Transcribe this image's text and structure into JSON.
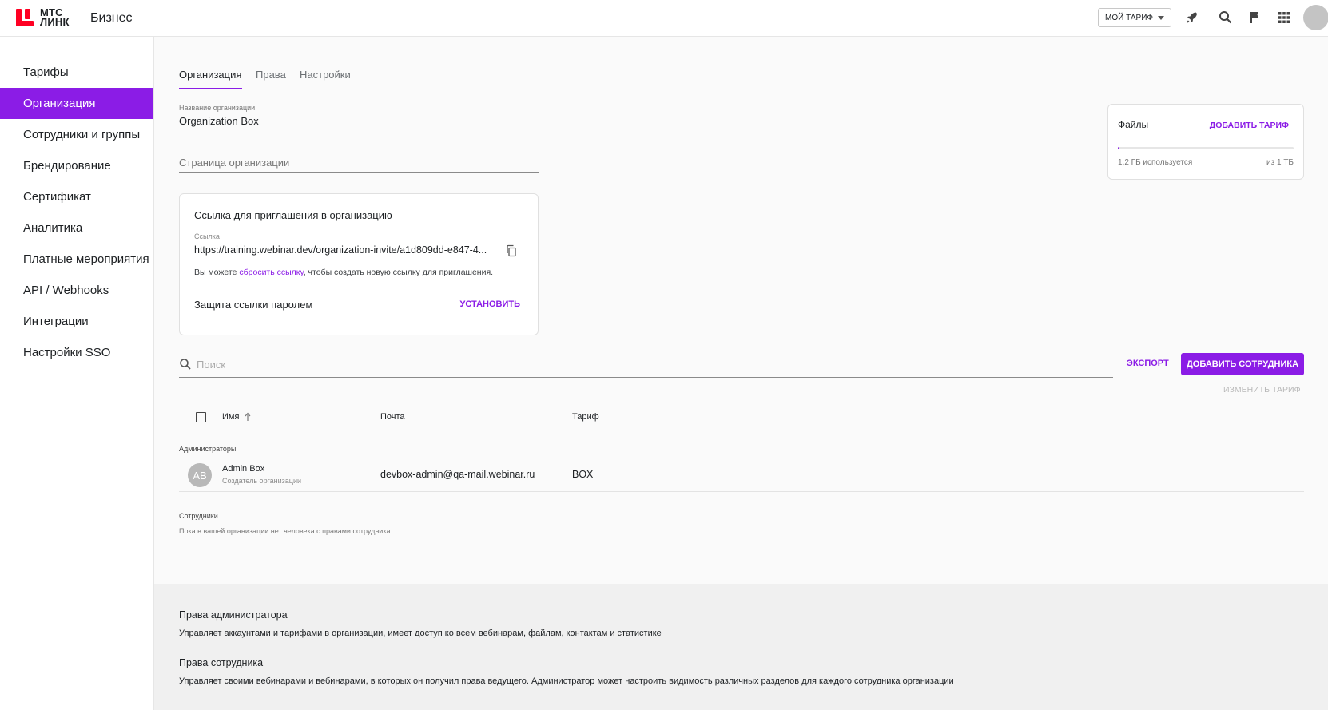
{
  "header": {
    "logo_line1": "МТС",
    "logo_line2": "ЛИНК",
    "product": "Бизнес",
    "tariff_button": "МОЙ ТАРИФ",
    "icons": [
      "rocket-icon",
      "search-icon",
      "flag-icon",
      "apps-grid-icon",
      "avatar"
    ]
  },
  "sidebar": {
    "items": [
      {
        "label": "Тарифы",
        "active": false
      },
      {
        "label": "Организация",
        "active": true
      },
      {
        "label": "Сотрудники и группы",
        "active": false
      },
      {
        "label": "Брендирование",
        "active": false
      },
      {
        "label": "Сертификат",
        "active": false
      },
      {
        "label": "Аналитика",
        "active": false
      },
      {
        "label": "Платные мероприятия",
        "active": false
      },
      {
        "label": "API / Webhooks",
        "active": false
      },
      {
        "label": "Интеграции",
        "active": false
      },
      {
        "label": "Настройки SSO",
        "active": false
      }
    ]
  },
  "tabs": [
    {
      "label": "Организация",
      "active": true
    },
    {
      "label": "Права",
      "active": false
    },
    {
      "label": "Настройки",
      "active": false
    }
  ],
  "org": {
    "name_label": "Название организации",
    "name_value": "Organization Box",
    "page_placeholder": "Страница организации"
  },
  "invite": {
    "title": "Ссылка для приглашения в организацию",
    "link_label": "Ссылка",
    "link_value": "https://training.webinar.dev/organization-invite/a1d809dd-e847-4...",
    "hint_before": "Вы можете ",
    "hint_link": "сбросить ссылку",
    "hint_after": ", чтобы создать новую ссылку для приглашения.",
    "password_label": "Защита ссылки паролем",
    "password_action": "УСТАНОВИТЬ"
  },
  "files": {
    "title": "Файлы",
    "add_label": "ДОБАВИТЬ ТАРИФ",
    "used": "1,2 ГБ используется",
    "total": "из 1 ТБ",
    "used_fraction": 0.0012
  },
  "search": {
    "placeholder": "Поиск",
    "value": ""
  },
  "actions": {
    "export": "ЭКСПОРТ",
    "add_employee": "ДОБАВИТЬ СОТРУДНИКА",
    "change_tariff": "ИЗМЕНИТЬ ТАРИФ"
  },
  "table": {
    "columns": [
      "Имя",
      "Почта",
      "Тариф"
    ],
    "admins_label": "Администраторы",
    "admins": [
      {
        "initials": "AB",
        "name": "Admin Box",
        "role": "Создатель организации",
        "email": "devbox-admin@qa-mail.webinar.ru",
        "tariff": "BOX"
      }
    ],
    "employees_label": "Сотрудники",
    "employees_empty": "Пока в вашей организации нет человека с правами сотрудника"
  },
  "info": {
    "admin_title": "Права администратора",
    "admin_desc": "Управляет аккаунтами и тарифами в организации, имеет доступ ко всем вебинарам, файлам, контактам и статистике",
    "employee_title": "Права сотрудника",
    "employee_desc": "Управляет своими вебинарами и вебинарами, в которых он получил права ведущего. Администратор может настроить видимость различных разделов для каждого сотрудника организации"
  },
  "colors": {
    "accent": "#8b1ce6",
    "brand_red": "#ff0023"
  }
}
